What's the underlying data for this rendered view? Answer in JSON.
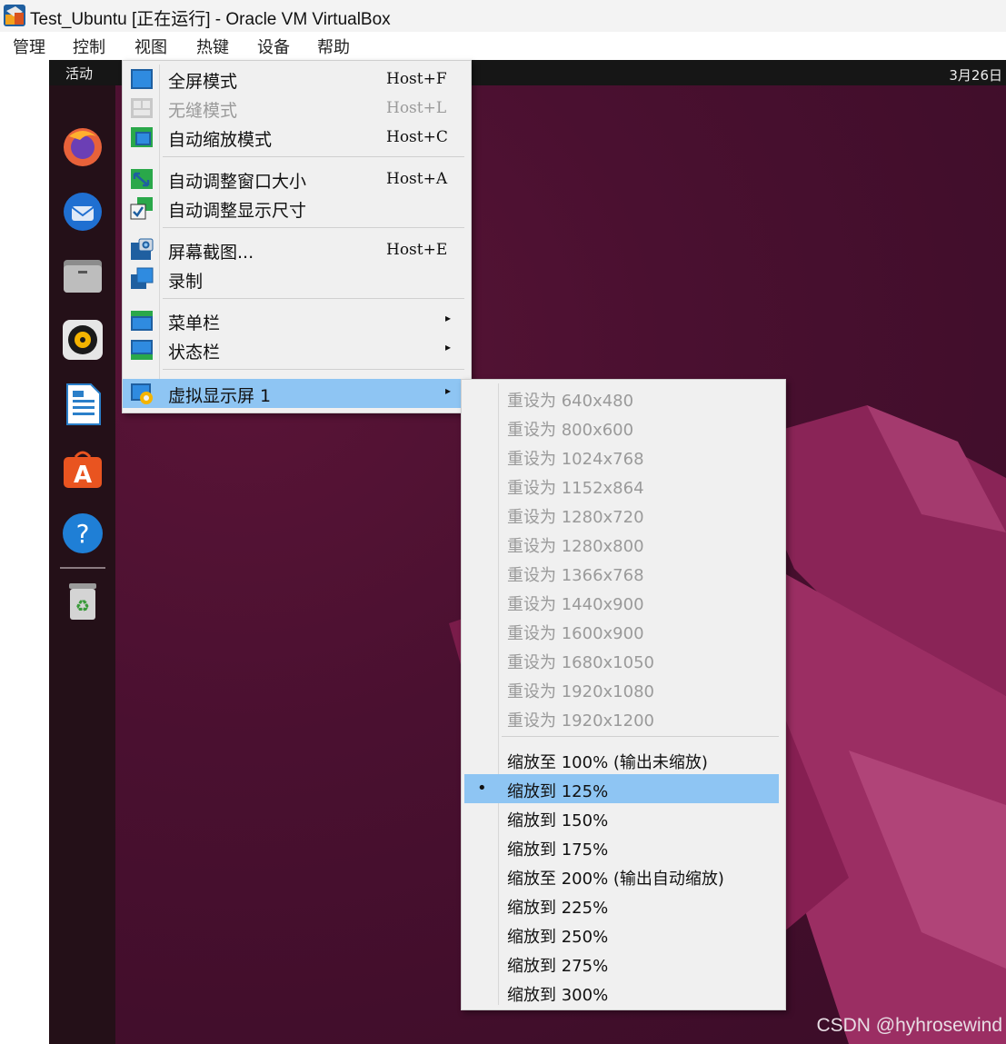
{
  "window": {
    "title": "Test_Ubuntu [正在运行] - Oracle VM VirtualBox"
  },
  "menubar": {
    "items": [
      "管理",
      "控制",
      "视图",
      "热键",
      "设备",
      "帮助"
    ]
  },
  "vm": {
    "activities": "活动",
    "clock": "3月26日",
    "dock_icons": [
      "firefox-icon",
      "thunderbird-icon",
      "files-icon",
      "rhythmbox-icon",
      "libreoffice-writer-icon",
      "software-icon",
      "help-icon",
      "trash-icon"
    ],
    "watermark": "CSDN @hyhrosewind"
  },
  "view_menu": {
    "items": [
      {
        "label": "全屏模式",
        "shortcut": "Host+F",
        "icon": "fullscreen-icon",
        "disabled": false
      },
      {
        "label": "无缝模式",
        "shortcut": "Host+L",
        "icon": "seamless-icon",
        "disabled": true
      },
      {
        "label": "自动缩放模式",
        "shortcut": "Host+C",
        "icon": "scale-mode-icon",
        "disabled": false
      },
      {
        "label": "自动调整窗口大小",
        "shortcut": "Host+A",
        "icon": "adjust-window-icon",
        "disabled": false
      },
      {
        "label": "自动调整显示尺寸",
        "shortcut": "",
        "icon": "auto-resize-icon",
        "disabled": false
      },
      {
        "label": "屏幕截图...",
        "shortcut": "Host+E",
        "icon": "screenshot-icon",
        "disabled": false
      },
      {
        "label": "录制",
        "shortcut": "",
        "icon": "record-icon",
        "disabled": false
      },
      {
        "label": "菜单栏",
        "shortcut": "",
        "icon": "menubar-icon",
        "disabled": false
      },
      {
        "label": "状态栏",
        "shortcut": "",
        "icon": "statusbar-icon",
        "disabled": false
      },
      {
        "label": "虚拟显示屏 1",
        "shortcut": "",
        "icon": "virtual-screen-icon",
        "disabled": false
      }
    ]
  },
  "screen_submenu": {
    "resize_items": [
      "重设为 640x480",
      "重设为 800x600",
      "重设为 1024x768",
      "重设为 1152x864",
      "重设为 1280x720",
      "重设为 1280x800",
      "重设为 1366x768",
      "重设为 1440x900",
      "重设为 1600x900",
      "重设为 1680x1050",
      "重设为 1920x1080",
      "重设为 1920x1200"
    ],
    "scale_items": [
      "缩放至 100% (输出未缩放)",
      "缩放到 125%",
      "缩放到 150%",
      "缩放到 175%",
      "缩放至 200% (输出自动缩放)",
      "缩放到 225%",
      "缩放到 250%",
      "缩放到 275%",
      "缩放到 300%"
    ],
    "selected_bullet": "•"
  },
  "colors": {
    "highlight": "#8ec5f3",
    "menu_bg": "#f0f0f0",
    "disabled_text": "#9a9a9a"
  }
}
